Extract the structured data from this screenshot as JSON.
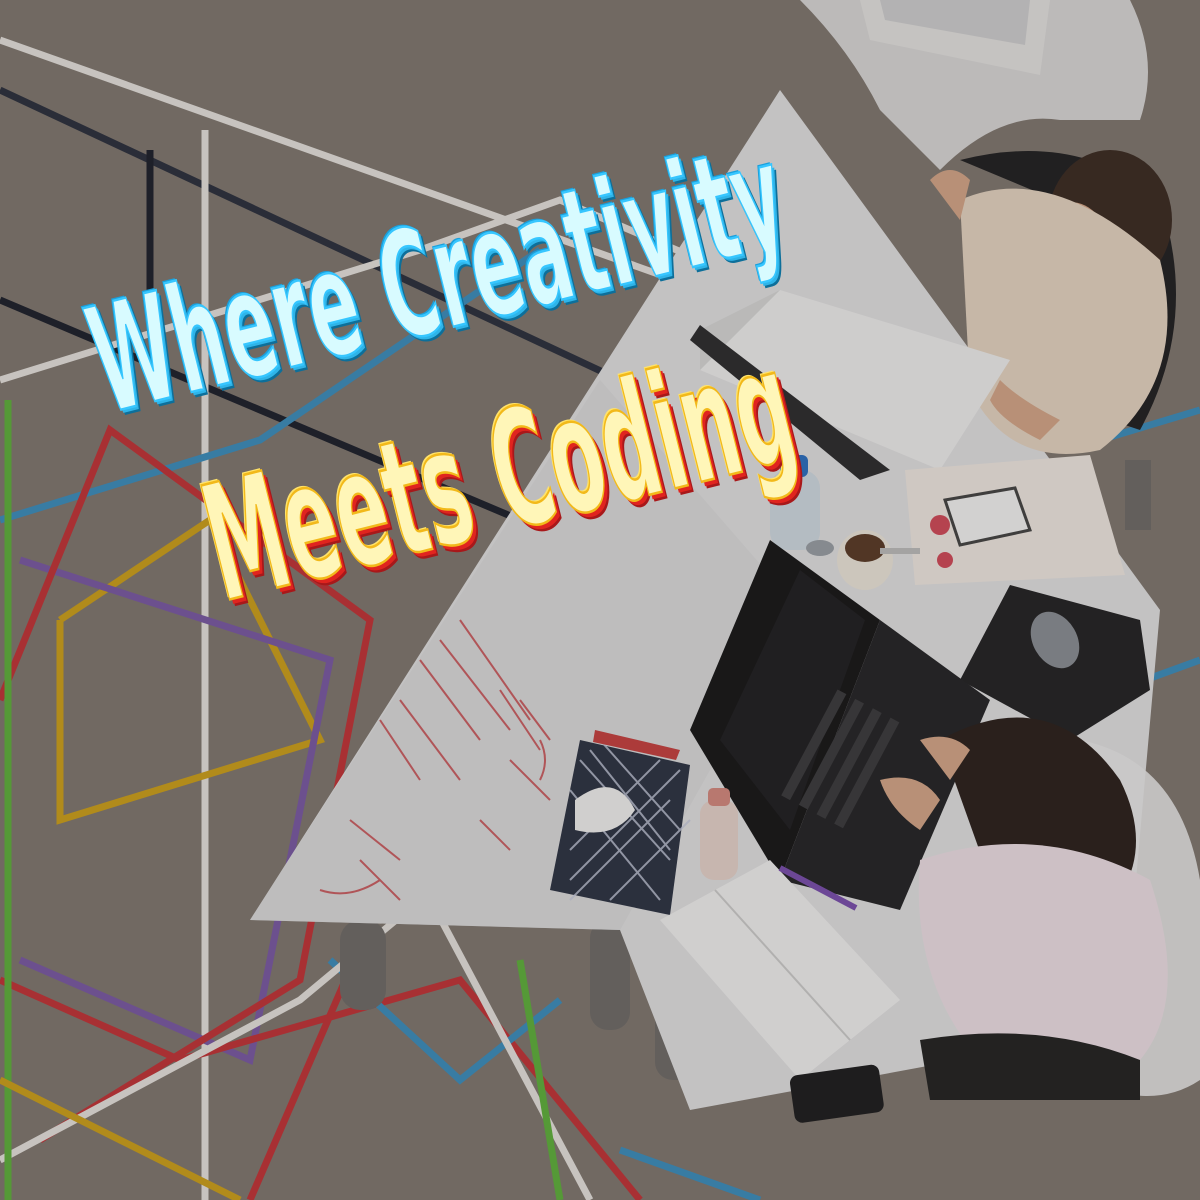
{
  "headline": {
    "line1": "Where Creativity",
    "line2": "Meets Coding"
  },
  "colors": {
    "line1_fill": "#d8fbff",
    "line1_outline": "#2fb4e8",
    "line2_fill": "#fff6b8",
    "line2_outline": "#e0241f",
    "floor": "#8a847c",
    "table": "#e9e9ea"
  }
}
